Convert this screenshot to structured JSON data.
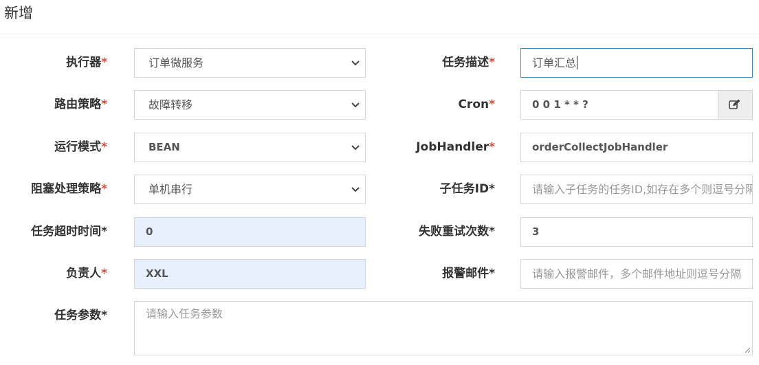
{
  "header": {
    "title": "新增"
  },
  "fields": {
    "executor": {
      "label": "执行器",
      "value": "订单微服务"
    },
    "job_desc": {
      "label": "任务描述",
      "value": "订单汇总"
    },
    "route_strategy": {
      "label": "路由策略",
      "value": "故障转移"
    },
    "cron": {
      "label": "Cron",
      "value": "0 0 1 * * ?",
      "edit_icon": "edit-icon"
    },
    "run_mode": {
      "label": "运行模式",
      "value": "BEAN"
    },
    "job_handler": {
      "label": "JobHandler",
      "value": "orderCollectJobHandler"
    },
    "block_strategy": {
      "label": "阻塞处理策略",
      "value": "单机串行"
    },
    "child_job_id": {
      "label": "子任务ID",
      "placeholder": "请输入子任务的任务ID,如存在多个则逗号分隔"
    },
    "timeout": {
      "label": "任务超时时间",
      "value": "0"
    },
    "retry_count": {
      "label": "失败重试次数",
      "value": "3"
    },
    "author": {
      "label": "负责人",
      "value": "XXL"
    },
    "alarm_email": {
      "label": "报警邮件",
      "placeholder": "请输入报警邮件，多个邮件地址则逗号分隔"
    },
    "job_param": {
      "label": "任务参数",
      "placeholder": "请输入任务参数"
    }
  },
  "required_mark": "*",
  "colors": {
    "required": "#dd4b39",
    "focus_border": "#3c8dbc",
    "autofill_bg": "#e8f0fe"
  }
}
